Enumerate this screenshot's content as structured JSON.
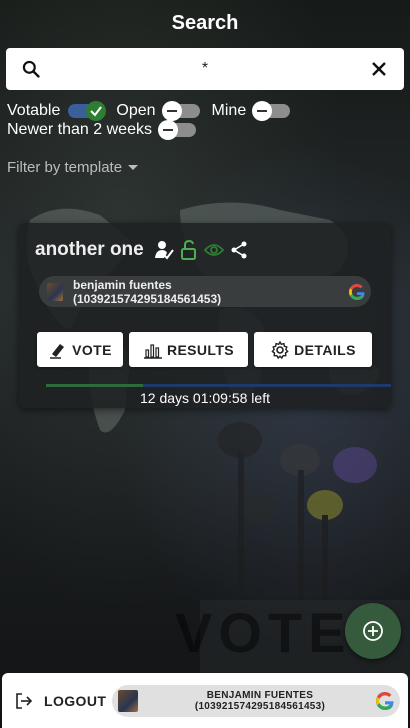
{
  "header": {
    "title": "Search"
  },
  "search": {
    "value": "*"
  },
  "filters": {
    "votable_label": "Votable",
    "votable_on": true,
    "open_label": "Open",
    "open_on": false,
    "mine_label": "Mine",
    "mine_on": false,
    "newer_label": "Newer than 2 weeks",
    "newer_on": false,
    "template_label": "Filter by template"
  },
  "poll": {
    "title": "another one",
    "author_name": "benjamin fuentes",
    "author_id": "(103921574295184561453)",
    "vote_label": "VOTE",
    "results_label": "RESULTS",
    "details_label": "DETAILS",
    "progress_fraction": 0.28,
    "time_left": "12 days 01:09:58 left"
  },
  "footer": {
    "logout_label": "LOGOUT",
    "user_name": "BENJAMIN FUENTES",
    "user_id": "(103921574295184561453)"
  },
  "colors": {
    "accent_green": "#2e7d32",
    "toggle_blue": "#3b5f9a",
    "fab_green": "#355a3c"
  }
}
